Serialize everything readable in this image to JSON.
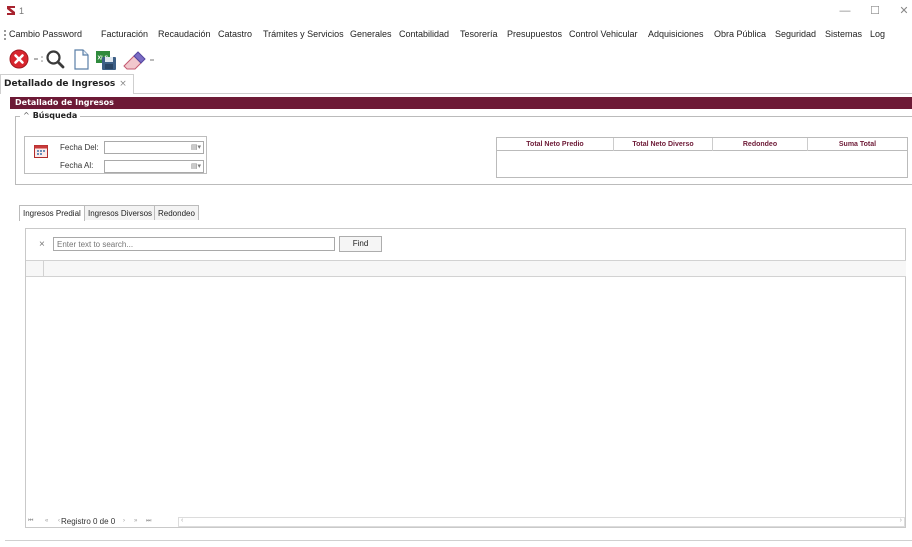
{
  "window": {
    "title": "1",
    "minimize": "—",
    "maximize": "☐",
    "close": "✕",
    "brand_color": "#a8232f"
  },
  "menu": {
    "items": [
      "Cambio Password",
      "Facturación",
      "Recaudación",
      "Catastro",
      "Trámites y Servicios",
      "Generales",
      "Contabilidad",
      "Tesorería",
      "Presupuestos",
      "Control Vehicular",
      "Adquisiciones",
      "Obra Pública",
      "Seguridad",
      "Sistemas",
      "Log"
    ]
  },
  "toolbar": {
    "icons": [
      "close-red-icon",
      "search-icon",
      "new-document-icon",
      "export-xls-icon",
      "eraser-icon"
    ]
  },
  "doc_tab": {
    "label": "Detallado de Ingresos",
    "close": "×"
  },
  "panel": {
    "header": "Detallado de Ingresos",
    "header_color": "#6d1a36",
    "search_group": {
      "caret": "^",
      "label": "Búsqueda",
      "fecha_del_label": "Fecha Del:",
      "fecha_al_label": "Fecha Al:",
      "fecha_del_value": "",
      "fecha_al_value": ""
    },
    "totals": {
      "columns": [
        "Total Neto Predio",
        "Total Neto Diverso",
        "Redondeo",
        "Suma Total"
      ],
      "rows": []
    }
  },
  "subtabs": {
    "items": [
      "Ingresos Predial",
      "Ingresos Diversos",
      "Redondeo"
    ],
    "active": 0
  },
  "grid": {
    "search_placeholder": "Enter text to search...",
    "search_value": "",
    "find_label": "Find",
    "clear": "×",
    "rows": []
  },
  "navigator": {
    "first": "⏮",
    "prev_page": "«",
    "prev": "‹",
    "record_text": "Registro 0 de 0",
    "next": "›",
    "next_page": "»",
    "last": "⏭",
    "scroll_left": "‹",
    "scroll_right": "›"
  }
}
